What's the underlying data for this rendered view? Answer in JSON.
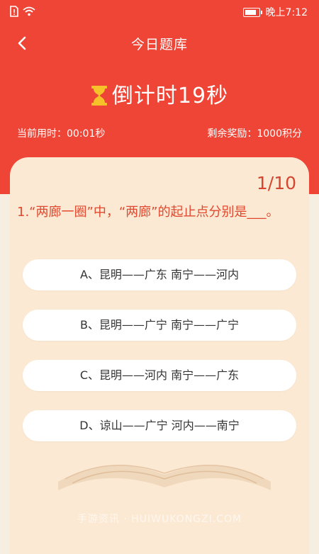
{
  "status": {
    "time": "晚上7:12",
    "battery_level": 0.85
  },
  "header": {
    "title": "今日题库"
  },
  "timer": {
    "label": "倒计时19秒"
  },
  "meta": {
    "elapsed": "当前用时：00:01秒",
    "reward": "剩余奖励：1000积分"
  },
  "quiz": {
    "progress": "1/10",
    "question": "1.“两廊一圈”中，“两廊”的起止点分别是___。",
    "options": [
      {
        "label": "A、昆明——广东 南宁——河内"
      },
      {
        "label": "B、昆明——广宁 南宁——广宁"
      },
      {
        "label": "C、昆明——河内 南宁——广东"
      },
      {
        "label": "D、谅山——广宁 河内——南宁"
      }
    ]
  },
  "watermark": "手游资讯 · HUIWUKONGZI.COM",
  "colors": {
    "accent": "#ee4536",
    "card": "#fbe9d3",
    "question": "#e0492f"
  }
}
